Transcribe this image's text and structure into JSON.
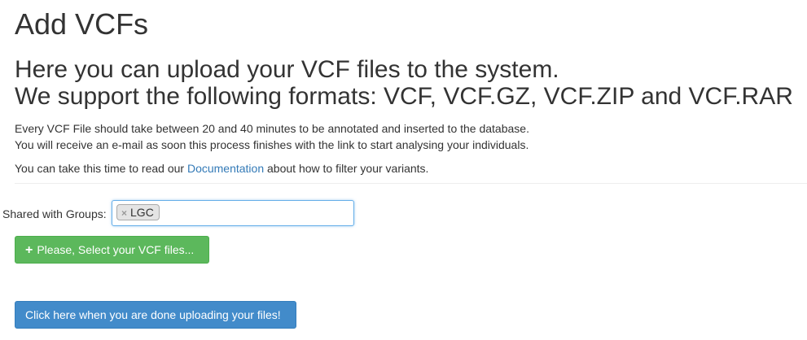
{
  "page": {
    "title": "Add VCFs"
  },
  "intro": {
    "heading_line1": "Here you can upload your VCF files to the system.",
    "heading_line2": "We support the following formats: VCF, VCF.GZ, VCF.ZIP and VCF.RAR"
  },
  "info": {
    "line1": "Every VCF File should take between 20 and 40 minutes to be annotated and inserted to the database.",
    "line2": "You will receive an e-mail as soon this process finishes with the link to start analysing your individuals."
  },
  "documentation": {
    "prefix": "You can take this time to read our ",
    "link_text": "Documentation",
    "suffix": " about how to filter your variants."
  },
  "groups": {
    "label": "Shared with Groups:",
    "selected": [
      {
        "remove_symbol": "×",
        "name": "LGC"
      }
    ]
  },
  "buttons": {
    "select_files": {
      "icon": "plus-icon",
      "icon_glyph": "+",
      "label": "Please, Select your VCF files..."
    },
    "done": {
      "label": "Click here when you are done uploading your files!"
    }
  },
  "colors": {
    "success": "#5cb85c",
    "primary": "#428bca",
    "link": "#337ab7",
    "focus_border": "#66afe9"
  }
}
